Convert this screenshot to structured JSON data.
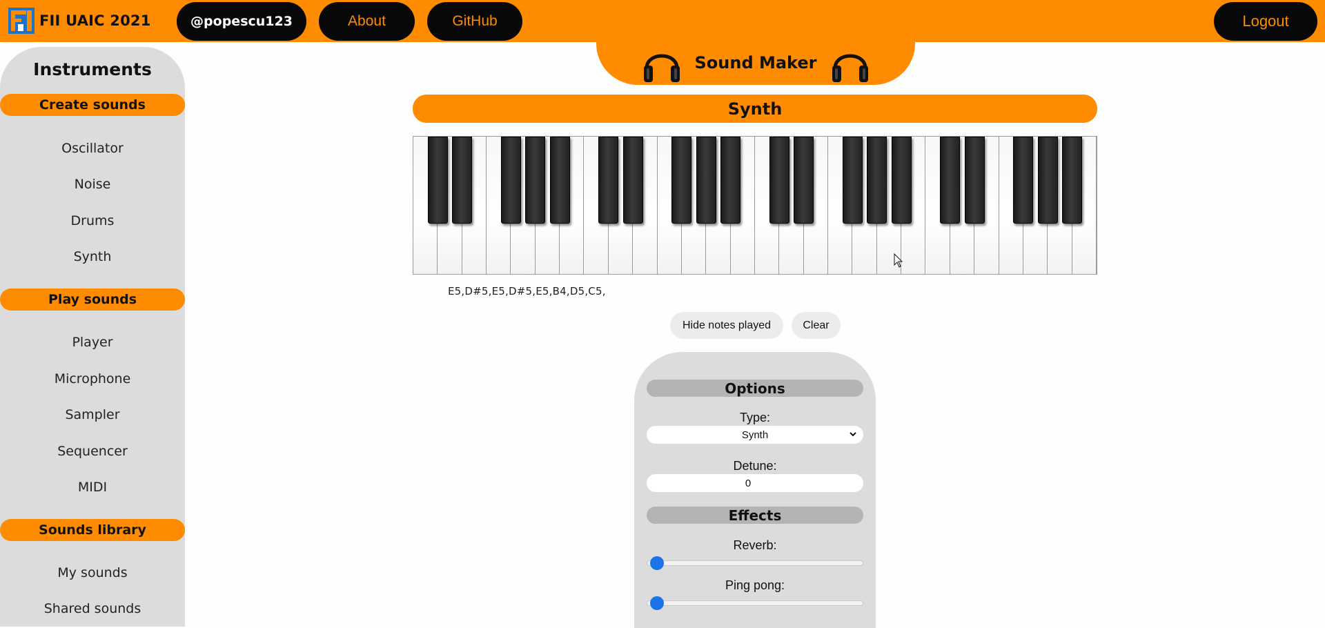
{
  "header": {
    "brand": "FII UAIC 2021",
    "user": "@popescu123",
    "about": "About",
    "github": "GitHub",
    "logout": "Logout"
  },
  "app_title": "Sound Maker",
  "sidebar": {
    "title": "Instruments",
    "sections": [
      {
        "label": "Create sounds",
        "items": [
          "Oscillator",
          "Noise",
          "Drums",
          "Synth"
        ]
      },
      {
        "label": "Play sounds",
        "items": [
          "Player",
          "Microphone",
          "Sampler",
          "Sequencer",
          "MIDI"
        ]
      },
      {
        "label": "Sounds library",
        "items": [
          "My sounds",
          "Shared sounds"
        ]
      }
    ]
  },
  "instrument_title": "Synth",
  "piano": {
    "white_keys": 28,
    "octaves": 4
  },
  "notes_played": "E5,D#5,E5,D#5,E5,B4,D5,C5,",
  "buttons": {
    "hide_notes": "Hide notes played",
    "clear": "Clear"
  },
  "options": {
    "title": "Options",
    "type_label": "Type:",
    "type_value": "Synth",
    "detune_label": "Detune:",
    "detune_value": "0",
    "effects_title": "Effects",
    "reverb_label": "Reverb:",
    "reverb_value": 0,
    "pingpong_label": "Ping pong:",
    "pingpong_value": 0
  },
  "colors": {
    "accent": "#ff8c00",
    "dark": "#080808",
    "panel": "#dcdcdc",
    "slider": "#1a73e8"
  },
  "icons": [
    "fii-logo-icon",
    "headphones-icon",
    "chevron-down-icon",
    "mouse-cursor-icon"
  ]
}
